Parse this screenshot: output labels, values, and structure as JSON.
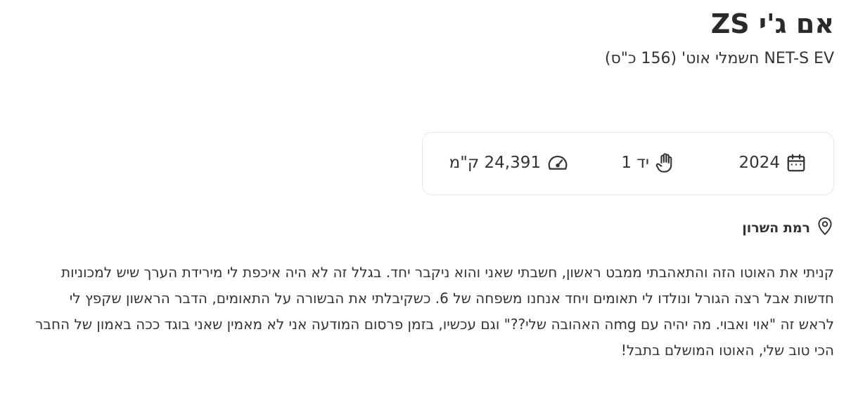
{
  "listing": {
    "title": "אם ג'י ZS",
    "subtitle": "NET-S EV חשמלי אוט' (156 כ\"ס)"
  },
  "specs": {
    "year": "2024",
    "hand": "יד 1",
    "mileage": "24,391 ק\"מ"
  },
  "location": "רמת השרון",
  "description": "קניתי את האוטו הזה והתאהבתי ממבט ראשון, חשבתי שאני והוא ניקבר יחד. בגלל זה לא היה איכפת לי מירידת הערך שיש למכוניות חדשות אבל רצה הגורל ונולדו לי תאומים ויחד אנחנו משפחה של 6. כשקיבלתי את הבשורה על התאומים, הדבר הראשון שקפץ לי לראש זה \"אוי ואבוי. מה יהיה עם mgה האהובה שלי??\" וגם עכשיו, בזמן פרסום המודעה אני לא מאמין שאני בוגד ככה באמון של החבר הכי טוב שלי, האוטו המושלם בתבל!",
  "icons": {
    "year": "calendar-icon",
    "hand": "hand-icon",
    "mileage": "speedometer-icon",
    "location": "location-pin-icon"
  }
}
